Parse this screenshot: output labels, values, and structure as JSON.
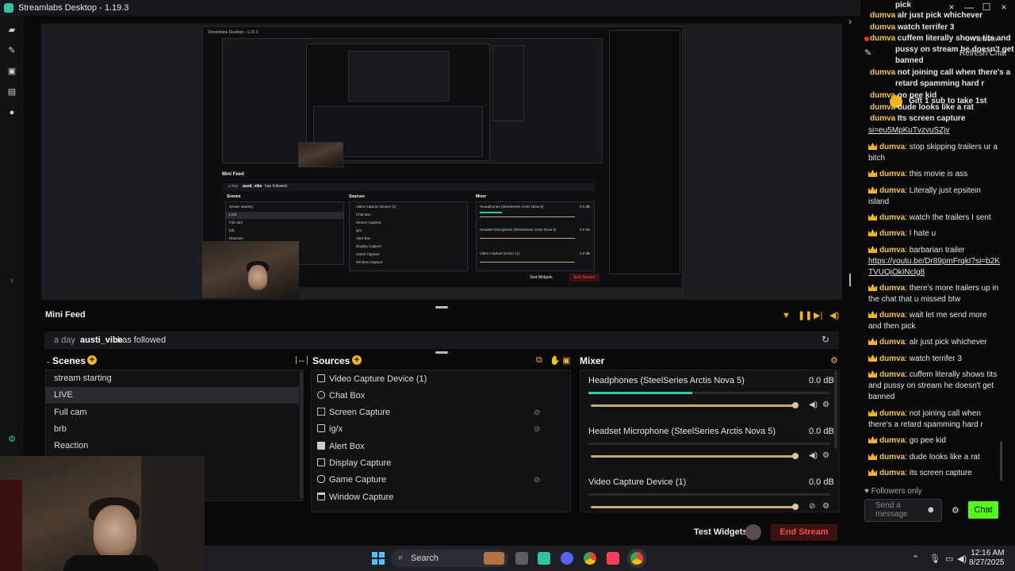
{
  "app": {
    "title": "Streamlabs Desktop - 1.19.3"
  },
  "nested_preview": {
    "title": "Streamlabs Desktop - 1.19.3",
    "mini_feed_title": "Mini Feed",
    "feed_time": "a day",
    "feed_user": "austi_vibe",
    "feed_action": "has followed",
    "scenes_title": "Scenes",
    "sources_title": "Sources",
    "mixer_title": "Mixer",
    "scenes": [
      "stream starting",
      "LIVE",
      "Full cam",
      "brb",
      "Reaction"
    ],
    "sources": [
      "Video Capture Device (1)",
      "Chat Box",
      "Screen Capture",
      "ig/x",
      "Alert Box",
      "Display Capture",
      "Game Capture",
      "Window Capture"
    ],
    "mixer": [
      "Headphones (SteelSeries Arctis Nova 5)",
      "Headset Microphone (SteelSeries Arctis Nova 5)",
      "Video Capture Device (1)"
    ],
    "db": "0.0 dB",
    "test_widgets": "Test Widgets",
    "end_stream": "End Stream"
  },
  "mini_feed": {
    "title": "Mini Feed",
    "time": "a day",
    "user": "austi_vibe",
    "action": "has followed"
  },
  "scenes": {
    "title": "Scenes",
    "items": [
      "stream starting",
      "LIVE",
      "Full cam",
      "brb",
      "Reaction"
    ],
    "active_index": 1
  },
  "sources": {
    "title": "Sources",
    "items": [
      {
        "label": "Video Capture Device (1)",
        "icon": "camera-icon"
      },
      {
        "label": "Chat Box",
        "icon": "chat-icon"
      },
      {
        "label": "Screen Capture",
        "icon": "screen-capture-icon"
      },
      {
        "label": "ig/x",
        "icon": "image-icon"
      },
      {
        "label": "Alert Box",
        "icon": "alert-icon"
      },
      {
        "label": "Display Capture",
        "icon": "monitor-icon"
      },
      {
        "label": "Game Capture",
        "icon": "gamepad-icon"
      },
      {
        "label": "Window Capture",
        "icon": "window-icon"
      }
    ]
  },
  "mixer": {
    "title": "Mixer",
    "channels": [
      {
        "name": "Headphones (SteelSeries Arctis Nova 5)",
        "db": "0.0 dB",
        "level": 0.43
      },
      {
        "name": "Headset Microphone (SteelSeries Arctis Nova 5)",
        "db": "0.0 dB",
        "level": 0
      },
      {
        "name": "Video Capture Device (1)",
        "db": "0.0 dB",
        "level": 0
      }
    ]
  },
  "controls": {
    "test_widgets": "Test Widgets",
    "end_stream": "End Stream"
  },
  "chat_top": {
    "pick": "pick",
    "lines": [
      {
        "user": "dumva",
        "text": "alr just pick whichever"
      },
      {
        "user": "dumva",
        "text": "watch terrifer 3"
      },
      {
        "user": "dumva",
        "text": "cuffem literally shows tits and"
      },
      {
        "user": "",
        "text": "pussy on stream he doesn't get"
      },
      {
        "user": "",
        "text": "banned"
      },
      {
        "user": "dumva",
        "text": "not joining call when there's a"
      },
      {
        "user": "",
        "text": "retard spamming hard r"
      },
      {
        "user": "dumva",
        "text": "go pee kid"
      },
      {
        "user": "dumva",
        "text": "dude looks like a rat"
      },
      {
        "user": "dumva",
        "text": "Its screen capture"
      }
    ],
    "overlay_viewers": "0 Viewers",
    "overlay_refresh": "Refresh Chat",
    "overlay_gift": "Gift 1 sub to take 1st",
    "link_tail": "si=eu5MpKuTvzvuSZjv"
  },
  "chat": {
    "messages": [
      {
        "user": "dumva",
        "text": "stop skipping trailers ur a bitch"
      },
      {
        "user": "dumva",
        "text": "this movie is ass"
      },
      {
        "user": "dumva",
        "text": "Literally just epsitein island"
      },
      {
        "user": "dumva",
        "text": "watch the trailers I sent"
      },
      {
        "user": "dumva",
        "text": "I hate u"
      },
      {
        "user": "dumva",
        "text": "barbarian trailer",
        "link": "https://youtu.be/Dr89pmFrqkI?si=b2KTVUQjOkINclg8"
      },
      {
        "user": "dumva",
        "text": "there's more trailers up in the chat that u missed btw"
      },
      {
        "user": "dumva",
        "text": "wait let me send more and then pick"
      },
      {
        "user": "dumva",
        "text": "alr just pick whichever"
      },
      {
        "user": "dumva",
        "text": "watch terrifer 3"
      },
      {
        "user": "dumva",
        "text": "cuffem literally shows tits and pussy on stream he doesn't get banned"
      },
      {
        "user": "dumva",
        "text": "not joining call when there's a retard spamming hard r"
      },
      {
        "user": "dumva",
        "text": "go pee kid"
      },
      {
        "user": "dumva",
        "text": "dude looks like a rat"
      },
      {
        "user": "dumva",
        "text": "its screen capture"
      }
    ],
    "followers_only": "Followers only",
    "input_placeholder": "Send a message",
    "send_label": "Chat"
  },
  "taskbar": {
    "search_label": "Search",
    "time": "12:16 AM",
    "date": "8/27/2025"
  },
  "colors": {
    "accent": "#31c3a2",
    "chat_green": "#53fc18",
    "end_stream_red": "#ff4a4a",
    "badge_gold": "#f1b523"
  }
}
